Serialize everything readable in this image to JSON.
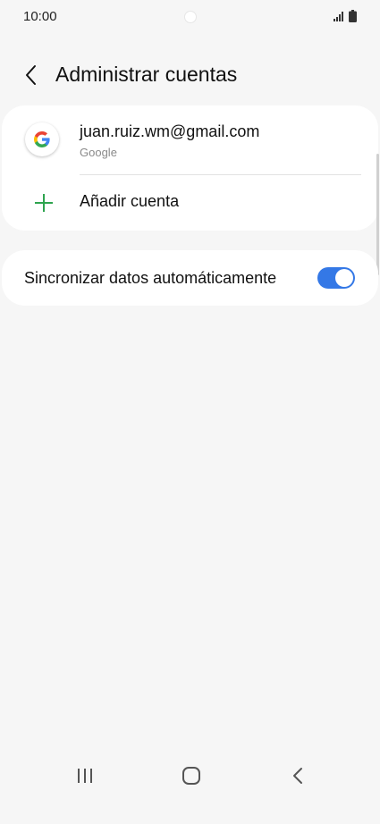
{
  "status_bar": {
    "time": "10:00",
    "icons": [
      "signal-icon",
      "battery-icon"
    ]
  },
  "header": {
    "title": "Administrar cuentas",
    "back_icon": "chevron-left-icon"
  },
  "accounts": [
    {
      "email": "juan.ruiz.wm@gmail.com",
      "type": "Google",
      "icon": "google-logo-icon"
    }
  ],
  "add_account": {
    "label": "Añadir cuenta",
    "icon": "plus-icon"
  },
  "sync": {
    "label": "Sincronizar datos automáticamente",
    "enabled": true
  },
  "navigation": {
    "icons": [
      "recents-icon",
      "home-icon",
      "back-icon"
    ]
  },
  "colors": {
    "toggle_on": "#3478e6",
    "plus_green": "#2ea44f",
    "background": "#f6f6f6"
  }
}
